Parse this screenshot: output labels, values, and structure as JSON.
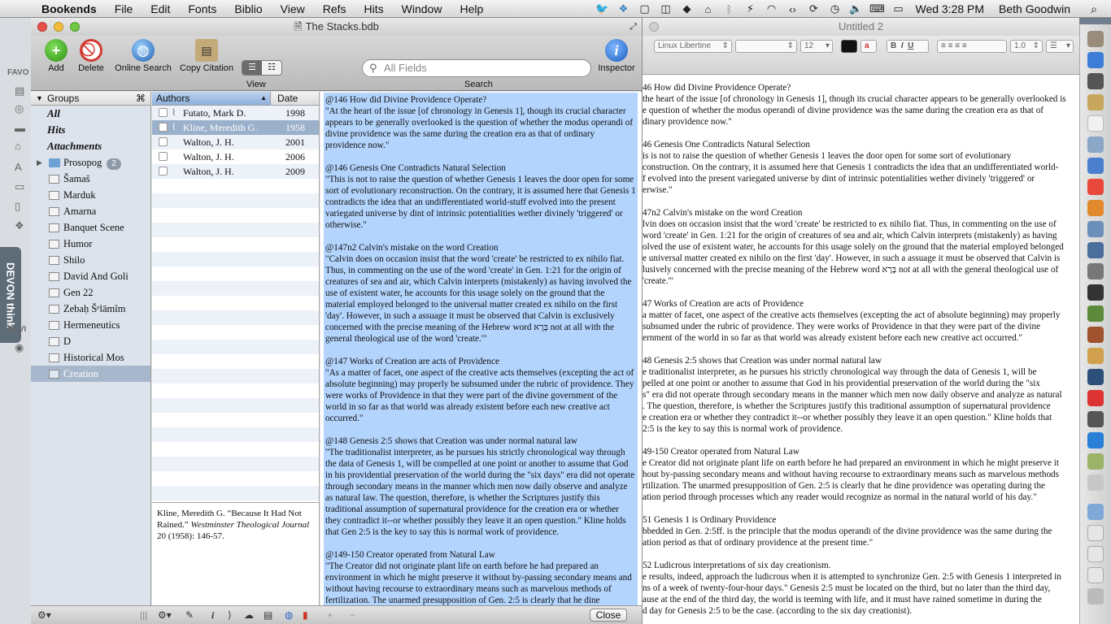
{
  "menubar": {
    "app": "Bookends",
    "menus": [
      "File",
      "Edit",
      "Fonts",
      "Biblio",
      "View",
      "Refs",
      "Hits",
      "Window",
      "Help"
    ],
    "clock": "Wed 3:28 PM",
    "user": "Beth Goodwin"
  },
  "sidebar": {
    "favorites_label": "FAVO",
    "devices_label": "DEVI",
    "devon_label": "DEVON think"
  },
  "bookends": {
    "title": "The Stacks.bdb",
    "toolbar": {
      "add": "Add",
      "delete": "Delete",
      "online_search": "Online Search",
      "copy_citation": "Copy Citation",
      "view": "View",
      "search": "Search",
      "inspector": "Inspector",
      "search_placeholder": "All Fields"
    },
    "groups_header": "Groups",
    "groups_cmd": "⌘",
    "groups_special": [
      "All",
      "Hits",
      "Attachments"
    ],
    "groups": [
      "Prosopog",
      "Šamaš",
      "Marduk",
      "Amarna",
      "Banquet Scene",
      "Humor",
      "Shilo",
      "David And Goli",
      "Gen 22",
      "Zebaḥ Šᵉlāmîm",
      "Hermeneutics",
      "D",
      "Historical Mos",
      "Creation"
    ],
    "prosopog_count": "2",
    "columns": {
      "authors": "Authors",
      "date": "Date"
    },
    "refs": [
      {
        "author": "Futato, Mark D.",
        "date": "1998"
      },
      {
        "author": "Kline, Meredith G.",
        "date": "1958"
      },
      {
        "author": "Walton, J. H.",
        "date": "2001"
      },
      {
        "author": "Walton, J. H.",
        "date": "2006"
      },
      {
        "author": "Walton, J. H.",
        "date": "2009"
      }
    ],
    "citation": {
      "prefix": "Kline, Meredith G. “Because It Had Not Rained.” ",
      "journal": "Westminster Theological Journal",
      "suffix": " 20 (1958): 146-57."
    },
    "notes": [
      {
        "head": "@146 How did Divine Providence Operate?",
        "body": "\"At the heart of the issue [of chronology in Genesis 1], though its crucial character appears to be generally overlooked is the question of whether the modus operandi of divine providence was the same during the creation era as that of ordinary providence now.\""
      },
      {
        "head": "@146 Genesis One Contradicts Natural Selection",
        "body": "\"This is not to raise the question of whether Genesis 1 leaves the door open for some sort of evolutionary reconstruction. On the contrary, it is assumed here that Genesis 1 contradicts the idea that an undifferentiated world-stuff evolved into the present variegated universe by dint of intrinsic potentialities wether divinely 'triggered' or otherwise.\""
      },
      {
        "head": "@147n2 Calvin's mistake on the word Creation",
        "body": "\"Calvin does on occasion insist that the word 'create' be restricted to ex nihilo fiat. Thus, in commenting on the use of the word 'create' in Gen. 1:21 for the origin of creatures of sea and air, which Calvin interprets (mistakenly) as having involved the use of existent water, he accounts for this usage solely on the ground that the material employed belonged to the universal matter created ex nihilo on the first 'day'. However, in such a assuage it must be observed that Calvin is exclusively concerned with the precise meaning of the Hebrew word בָּרָא not at all with the general theological use of the word 'create.'\""
      },
      {
        "head": "@147 Works of Creation are acts of Providence",
        "body": "\"As a matter of facet, one aspect of the creative acts themselves (excepting the act of absolute beginning) may properly be subsumed under the rubric of providence. They were works of Providence in that they were part of the divine government of the world in so far as that world was already existent before each new creative act occurred.\""
      },
      {
        "head": "@148 Genesis 2:5 shows that Creation was under normal natural law",
        "body": "\"The traditionalist interpreter, as he pursues his strictly chronological way through the data of Genesis 1, will be compelled at one point or another to assume that God in his providential preservation of the world during the \"six days\" era did not operate through secondary means in the manner which men now daily observe and analyze as natural law. The question, therefore, is whether the Scriptures justify this traditional assumption of supernatural providence for the creation era or whether they contradict it--or whether possibly they leave it an open question.\" Kline holds that Gen 2:5 is the key to say this is normal work of providence."
      },
      {
        "head": "@149-150 Creator operated from Natural Law",
        "body": "\"The Creator did not originate plant life on earth before he had prepared an environment in which he might preserve it without by-passing secondary means and without having recourse to extraordinary means such as marvelous methods of fertilization. The unarmed presupposition of Gen. 2:5 is clearly that he dine providence was operating during the creation period through processes which any reader would recognize as normal in the natural world of his day.\""
      }
    ],
    "close": "Close"
  },
  "untitled": {
    "title": "Untitled 2",
    "font": "Linux Libertine",
    "size": "12",
    "spacing": "1.0",
    "ruler_numbers": [
      "1",
      "2",
      "3",
      "4",
      "5",
      "6",
      "7"
    ],
    "lines": [
      [
        "46 How did Divine Providence Operate?",
        "the heart of the issue [of chronology in Genesis 1], though its crucial character appears to be generally overlooked is",
        "e question of whether the modus operandi of divine providence was the same during the creation era as that of",
        "dinary providence now.\""
      ],
      [
        "46 Genesis One Contradicts Natural Selection",
        "is is not to raise the question of whether Genesis 1 leaves the door open for some sort of evolutionary",
        "construction. On the contrary, it is assumed here that Genesis 1 contradicts the idea that an undifferentiated world-",
        "f evolved into the present variegated universe by dint of intrinsic potentialities wether divinely 'triggered' or",
        "erwise.\""
      ],
      [
        "47n2 Calvin's mistake on the word Creation",
        "lvin does on occasion insist that the word 'create' be restricted to ex nihilo fiat. Thus, in commenting on the use of",
        "word 'create' in Gen. 1:21 for the origin of creatures of sea and air, which Calvin interprets (mistakenly) as having",
        "olved the use of existent water, he accounts for this usage solely on the ground that the material employed belonged",
        "e universal matter created ex nihilo on the first 'day'. However, in such a assuage it must be observed that Calvin is",
        "lusively concerned with the precise meaning of the Hebrew word בָּרָא not at all with the general theological use of",
        "'create.'\""
      ],
      [
        "47 Works of Creation are acts of Providence",
        "a matter of facet, one aspect of the creative acts themselves (excepting the act of absolute beginning) may properly",
        "subsumed under the rubric of providence. They were works of Providence in that they were part of the divine",
        "ernment of the world in so far as that world was already existent before each new creative act occurred.\""
      ],
      [
        "48 Genesis 2:5 shows that Creation was under normal natural law",
        "e traditionalist interpreter, as he pursues his strictly chronological way through the data of Genesis 1, will be",
        "pelled at one point or another to assume that God in his providential preservation of the world during the \"six",
        "s\" era did not operate through secondary means in the manner which men now daily observe and analyze as natural",
        ". The question, therefore, is whether the Scriptures justify this traditional assumption of supernatural providence",
        "e creation era or whether they contradict it--or whether possibly they leave it an open question.\" Kline holds that",
        "2:5 is the key to say this is normal work of providence."
      ],
      [
        "49-150 Creator operated from Natural Law",
        "e Creator did not originate plant life on earth before he had prepared an environment in which he might preserve it",
        "hout by-passing secondary means and without having recourse to extraordinary means such as marvelous methods",
        "rtilization. The unarmed presupposition of Gen. 2:5 is clearly that he dine providence was operating during the",
        "ation period through processes which any reader would recognize as normal in the natural world of his day.\""
      ],
      [
        "51 Genesis 1 is Ordinary Providence",
        "bbedded in Gen. 2:5ff. is the principle that the modus operandi of the divine providence was the same during the",
        "ation period as that of ordinary providence at the present time.\""
      ],
      [
        "52 Ludicrous interpretations of six day creationism.",
        "e results, indeed, approach the ludicrous when it is attempted to synchronize Gen. 2:5 with Genesis 1 interpreted in",
        "ns of a week of twenty-four-hour days.\" Genesis 2:5 must be located on the third, but no later than the third day,",
        "ause at the end of the third day, the world is teeming with life, and it must have rained sometime in during the",
        "d day for Genesis 2:5 to be the case. (according to the six day creationist)."
      ]
    ]
  }
}
